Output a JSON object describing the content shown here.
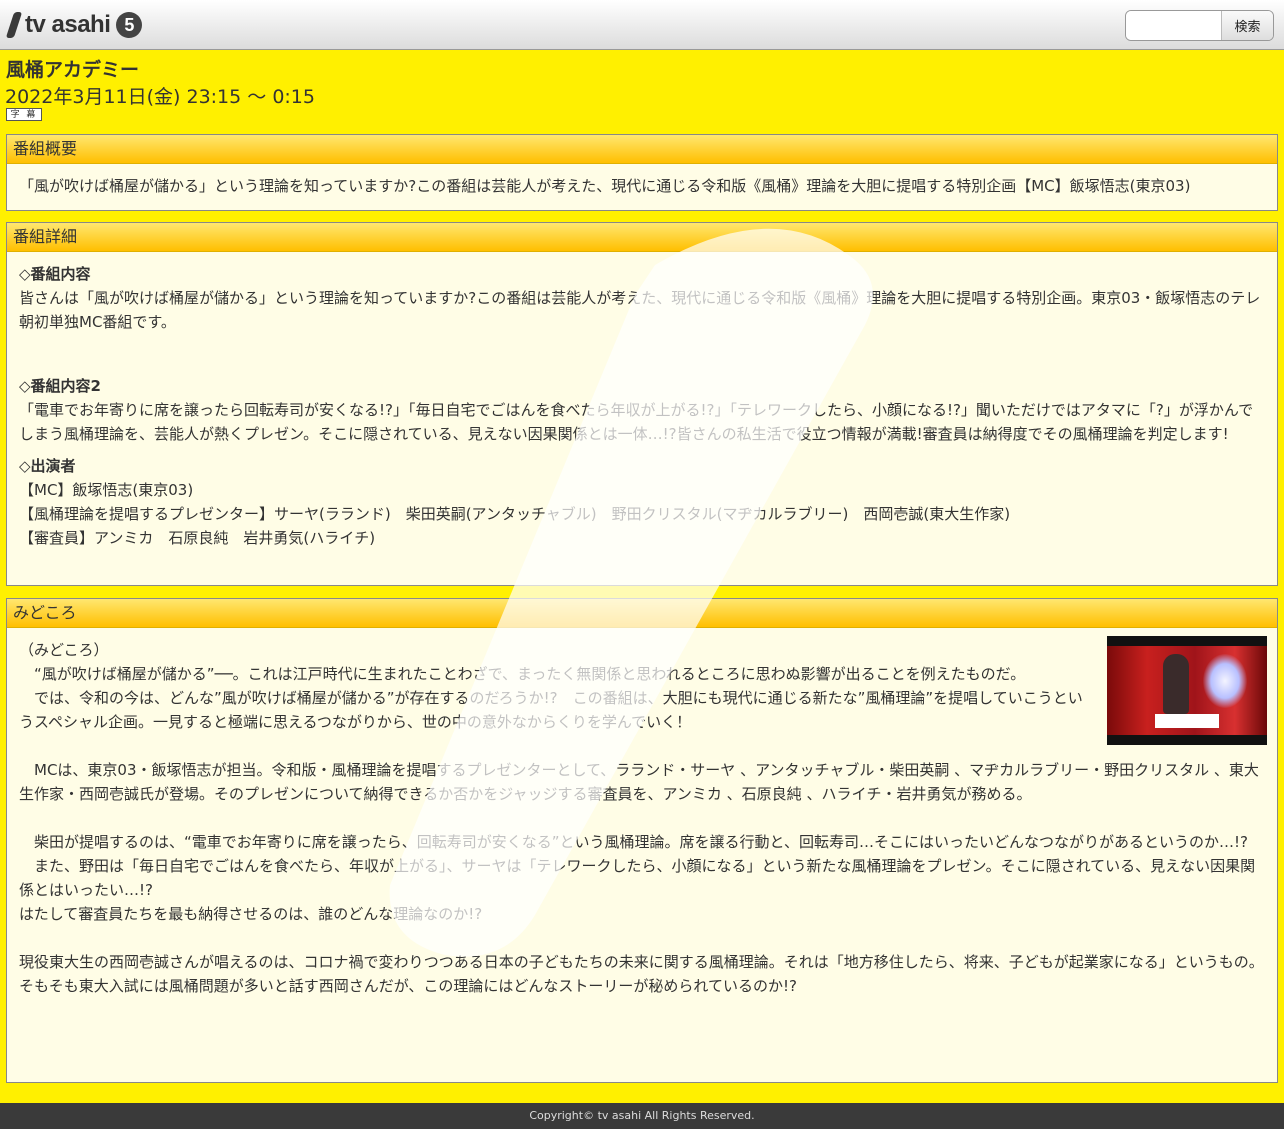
{
  "header": {
    "logo_text": "tv asahi",
    "logo_badge": "5",
    "search_placeholder": "",
    "search_button": "検索"
  },
  "program": {
    "title": "風桶アカデミー",
    "datetime": "2022年3月11日(金) 23:15 ～ 0:15",
    "caption_badge": "字 幕"
  },
  "overview": {
    "heading": "番組概要",
    "text": "「風が吹けば桶屋が儲かる」という理論を知っていますか?この番組は芸能人が考えた、現代に通じる令和版《風桶》理論を大胆に提唱する特別企画【MC】飯塚悟志(東京03)"
  },
  "details": {
    "heading": "番組詳細",
    "content_title": "◇番組内容",
    "content_text": "皆さんは「風が吹けば桶屋が儲かる」という理論を知っていますか?この番組は芸能人が考えた、現代に通じる令和版《風桶》理論を大胆に提唱する特別企画。東京03・飯塚悟志のテレ朝初単独MC番組です。",
    "content2_title": "◇番組内容2",
    "content2_text": "「電車でお年寄りに席を譲ったら回転寿司が安くなる!?」「毎日自宅でごはんを食べたら年収が上がる!?」「テレワークしたら、小顔になる!?」聞いただけではアタマに「?」が浮かんでしまう風桶理論を、芸能人が熱くプレゼン。そこに隠されている、見えない因果関係とは一体…!?皆さんの私生活で役立つ情報が満載!審査員は納得度でその風桶理論を判定します!",
    "cast_title": "◇出演者",
    "cast_lines": [
      "【MC】飯塚悟志(東京03)",
      "【風桶理論を提唱するプレゼンター】サーヤ(ラランド)　柴田英嗣(アンタッチャブル)　野田クリスタル(マヂカルラブリー)　西岡壱誠(東大生作家)",
      "【審査員】アンミカ　石原良純　岩井勇気(ハライチ)"
    ]
  },
  "highlights": {
    "heading": "みどころ",
    "thumb_icon": "program-thumbnail-image",
    "paragraphs": [
      "（みどころ）",
      "",
      "　“風が吹けば桶屋が儲かる”──。これは江戸時代に生まれたことわざで、まったく無関係と思われるところに思わぬ影響が出ることを例えたものだ。",
      "　では、令和の今は、どんな”風が吹けば桶屋が儲かる”が存在するのだろうか!?　この番組は、大胆にも現代に通じる新たな”風桶理論”を提唱していこうというスペシャル企画。一見すると極端に思えるつながりから、世の中の意外なからくりを学んでいく！",
      "",
      "　MCは、東京03・飯塚悟志が担当。令和版・風桶理論を提唱するプレゼンターとして、ラランド・サーヤ 、アンタッチャブル・柴田英嗣 、マヂカルラブリー・野田クリスタル 、東大生作家・西岡壱誠氏が登場。そのプレゼンについて納得できるか否かをジャッジする審査員を、アンミカ 、石原良純 、ハライチ・岩井勇気が務める。",
      "",
      "　柴田が提唱するのは、“電車でお年寄りに席を譲ったら、回転寿司が安くなる”という風桶理論。席を譲る行動と、回転寿司…そこにはいったいどんなつながりがあるというのか…!?",
      "　また、野田は「毎日自宅でごはんを食べたら、年収が上がる」、サーヤは「テレワークしたら、小顔になる」という新たな風桶理論をプレゼン。そこに隠されている、見えない因果関係とはいったい…!?",
      "はたして審査員たちを最も納得させるのは、誰のどんな理論なのか!?",
      "",
      "現役東大生の西岡壱誠さんが唱えるのは、コロナ禍で変わりつつある日本の子どもたちの未来に関する風桶理論。それは「地方移住したら、将来、子どもが起業家になる」というもの。",
      "そもそも東大入試には風桶問題が多いと話す西岡さんだが、この理論にはどんなストーリーが秘められているのか!?"
    ]
  },
  "footer": {
    "copyright": "Copyright© tv asahi All Rights Reserved."
  }
}
